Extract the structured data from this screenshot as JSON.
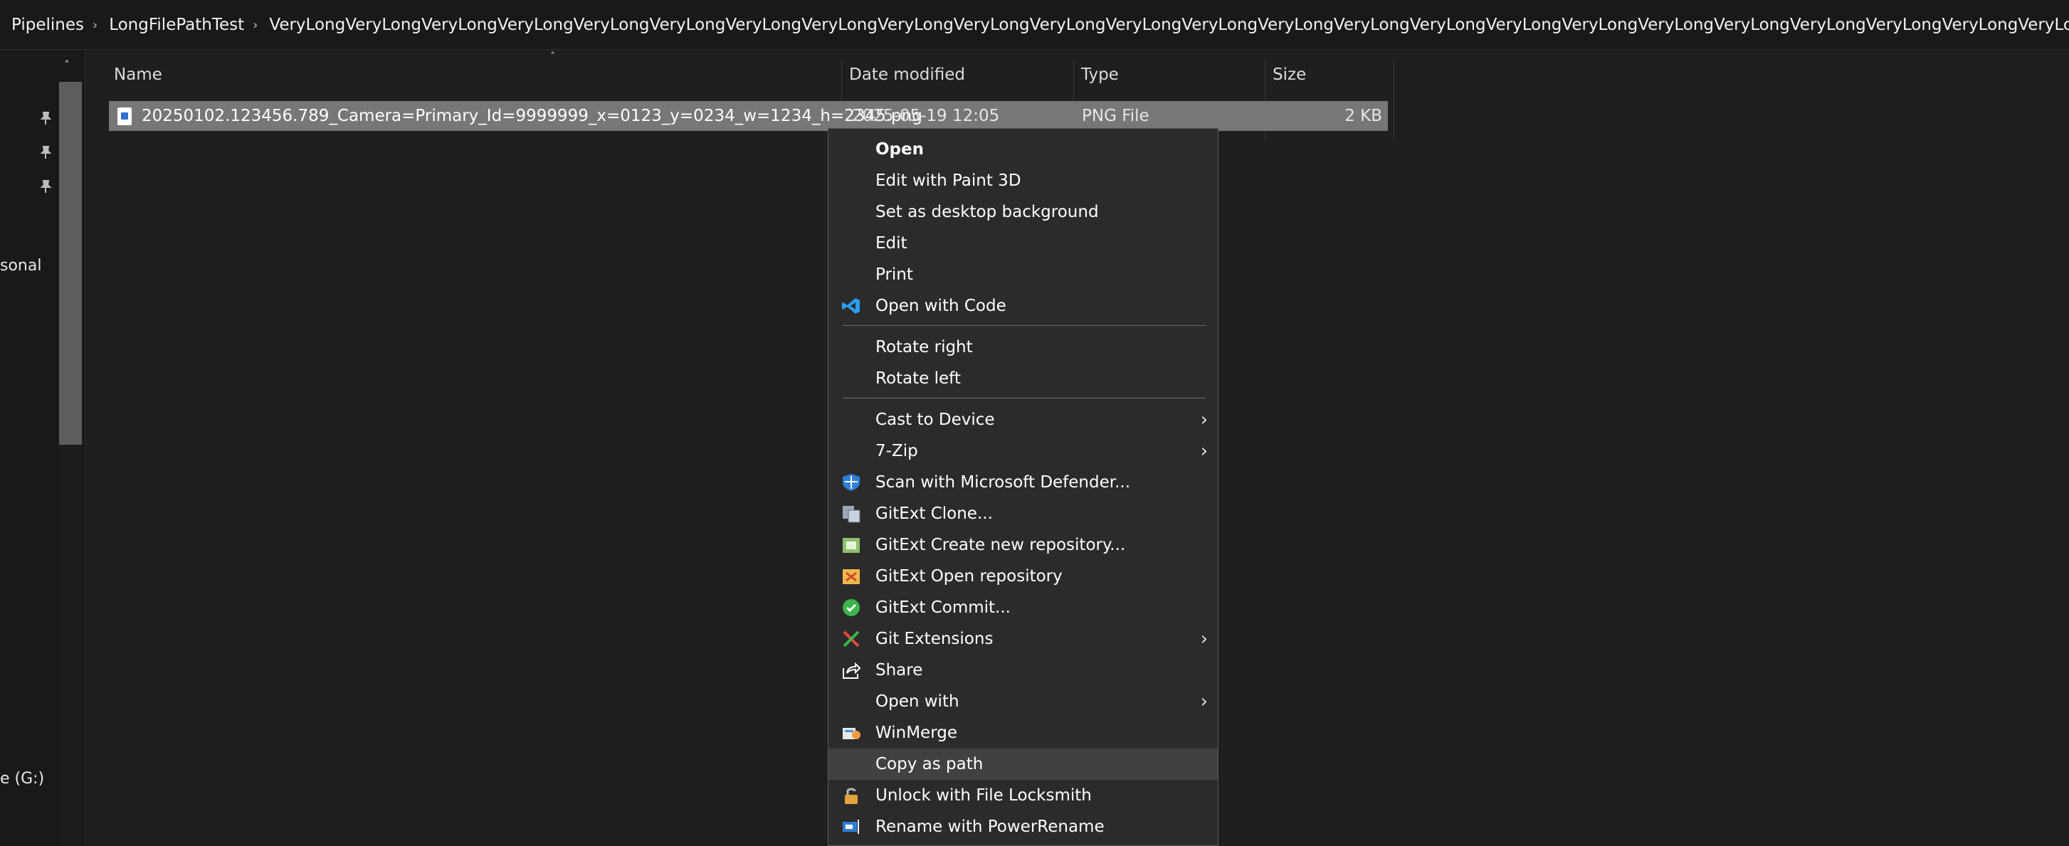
{
  "breadcrumb": {
    "items": [
      "Pipelines",
      "LongFilePathTest",
      "VeryLongVeryLongVeryLongVeryLongVeryLongVeryLongVeryLongVeryLongVeryLongVeryLongVeryLongVeryLongVeryLongVeryLongVeryLongVeryLongVeryLongVeryLongVeryLongVeryLongVeryLongVeryLongVeryLongVeryLongVeryLongVeryLongVeryLongVeryLongVeryLongVeryLongVeryLongVeryLongVery"
    ]
  },
  "nav": {
    "pinned_count": 3,
    "partial_items": [
      "sonal",
      "e (G:)"
    ]
  },
  "columns": {
    "name": "Name",
    "date": "Date modified",
    "type": "Type",
    "size": "Size"
  },
  "file": {
    "name": "20250102.123456.789_Camera=Primary_Id=9999999_x=0123_y=0234_w=1234_h=2345.png",
    "date": "2025-05-19 12:05",
    "type": "PNG File",
    "size": "2 KB"
  },
  "context_menu": {
    "items": [
      {
        "label": "Open",
        "icon": "",
        "bold": true
      },
      {
        "label": "Edit with Paint 3D",
        "icon": ""
      },
      {
        "label": "Set as desktop background",
        "icon": ""
      },
      {
        "label": "Edit",
        "icon": ""
      },
      {
        "label": "Print",
        "icon": ""
      },
      {
        "label": "Open with Code",
        "icon": "vscode-icon"
      },
      {
        "label": "Rotate right",
        "icon": ""
      },
      {
        "label": "Rotate left",
        "icon": ""
      },
      {
        "label": "Cast to Device",
        "icon": "",
        "submenu": true
      },
      {
        "label": "7-Zip",
        "icon": "",
        "submenu": true
      },
      {
        "label": "Scan with Microsoft Defender...",
        "icon": "defender-shield-icon"
      },
      {
        "label": "GitExt Clone...",
        "icon": "gitext-clone-icon"
      },
      {
        "label": "GitExt Create new repository...",
        "icon": "gitext-create-repo-icon"
      },
      {
        "label": "GitExt Open repository",
        "icon": "gitext-open-repo-icon"
      },
      {
        "label": "GitExt Commit...",
        "icon": "gitext-commit-icon"
      },
      {
        "label": "Git Extensions",
        "icon": "git-extensions-icon",
        "submenu": true
      },
      {
        "label": "Share",
        "icon": "share-icon"
      },
      {
        "label": "Open with",
        "icon": "",
        "submenu": true
      },
      {
        "label": "WinMerge",
        "icon": "winmerge-icon"
      },
      {
        "label": "Copy as path",
        "icon": "",
        "hover": true
      },
      {
        "label": "Unlock with File Locksmith",
        "icon": "lock-icon"
      },
      {
        "label": "Rename with PowerRename",
        "icon": "powerrename-icon"
      }
    ],
    "submenu_glyph": "›"
  },
  "colors": {
    "background": "#191919",
    "content": "#1f1f1f",
    "selected_row": "#777777",
    "menu": "#2b2b2b",
    "menu_hover": "#414141"
  }
}
